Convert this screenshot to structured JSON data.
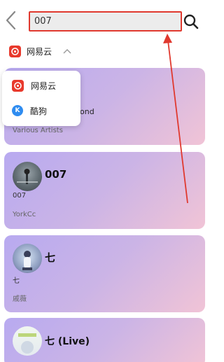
{
  "header": {
    "search_value": "007"
  },
  "source": {
    "selected_label": "网易云"
  },
  "dropdown": {
    "items": [
      {
        "label": "网易云"
      },
      {
        "label": "酷狗",
        "badge": "K"
      }
    ]
  },
  "results": [
    {
      "title": "ond",
      "subtitle": "",
      "artist": "Various Artists"
    },
    {
      "title": "007",
      "subtitle": "007",
      "artist": "YorkCc"
    },
    {
      "title": "七",
      "subtitle": "七",
      "artist": "戚薇"
    },
    {
      "title": "七 (Live)",
      "subtitle": "",
      "artist": ""
    }
  ],
  "colors": {
    "highlight": "#e0392f",
    "netease": "#e8392c",
    "kugou": "#2f8cf0"
  }
}
